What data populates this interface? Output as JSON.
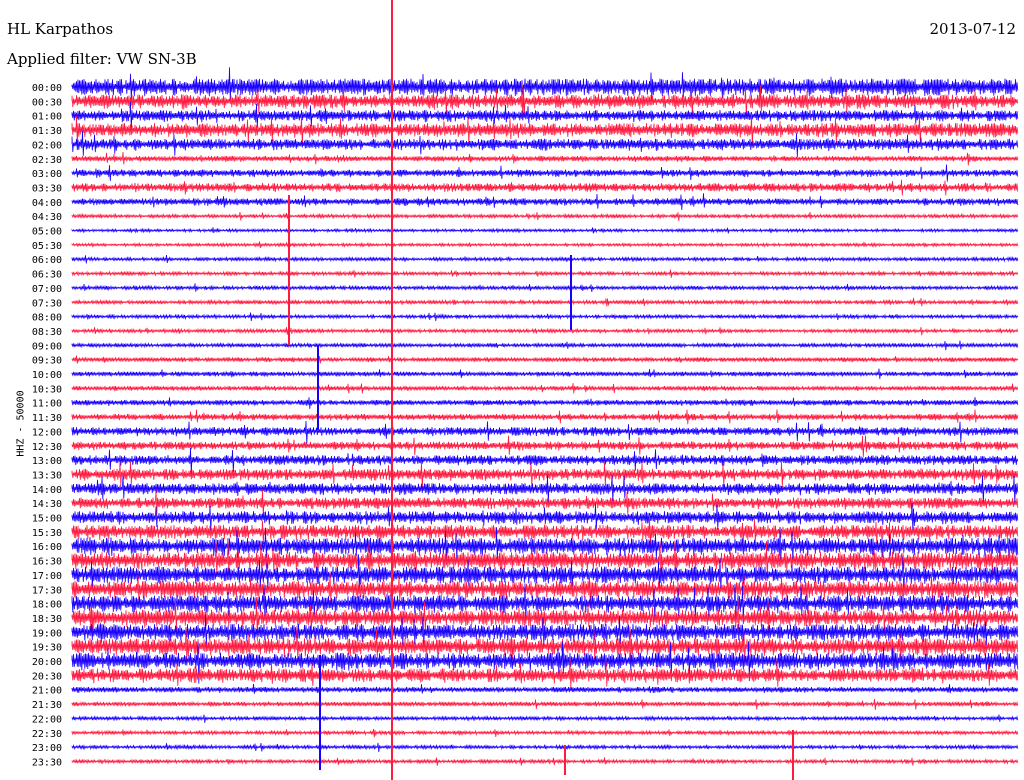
{
  "header": {
    "station": "HL Karpathos",
    "date": "2013-07-12",
    "filter": "Applied filter: VW SN-3B"
  },
  "chart_data": {
    "type": "line",
    "title": "HL Karpathos",
    "ylabel": "HHZ - 50000",
    "colors": [
      "#1a00ff",
      "#ff1a40"
    ],
    "row_labels": [
      "00:00",
      "00:30",
      "01:00",
      "01:30",
      "02:00",
      "02:30",
      "03:00",
      "03:30",
      "04:00",
      "04:30",
      "05:00",
      "05:30",
      "06:00",
      "06:30",
      "07:00",
      "07:30",
      "08:00",
      "08:30",
      "09:00",
      "09:30",
      "10:00",
      "10:30",
      "11:00",
      "11:30",
      "12:00",
      "12:30",
      "13:00",
      "13:30",
      "14:00",
      "14:30",
      "15:00",
      "15:30",
      "16:00",
      "16:30",
      "17:00",
      "17:30",
      "18:00",
      "18:30",
      "19:00",
      "19:30",
      "20:00",
      "20:30",
      "21:00",
      "21:30",
      "22:00",
      "22:30",
      "23:00",
      "23:30"
    ],
    "noise_level": [
      6,
      5,
      4,
      5,
      4,
      2,
      2.5,
      3,
      2.5,
      1.2,
      1,
      1,
      1.2,
      1.2,
      1.3,
      1.3,
      1.2,
      1.2,
      1.4,
      1.6,
      1.6,
      1.6,
      2,
      2.2,
      3,
      3,
      3.5,
      4,
      4,
      4,
      4.5,
      5,
      6,
      6,
      6,
      6,
      6,
      6,
      6,
      6,
      6,
      5,
      2,
      1.5,
      1.2,
      1.2,
      1.2,
      1.2
    ]
  }
}
